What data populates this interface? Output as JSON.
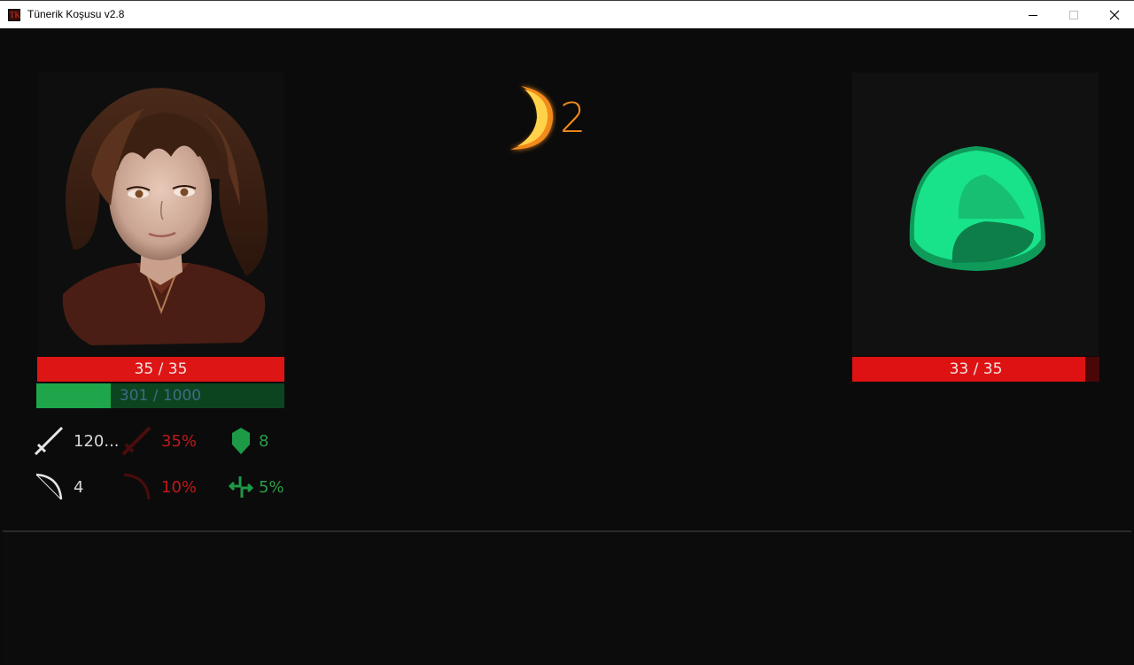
{
  "window": {
    "title": "Tünerik Koşusu v2.8",
    "icon_label": "TK"
  },
  "player": {
    "hp_text": "35 / 35",
    "hp_fraction": 1.0,
    "xp_text": "301 / 1000",
    "xp_fraction": 0.301
  },
  "enemy": {
    "hp_text": "33 / 35",
    "hp_fraction": 0.943
  },
  "turn": {
    "count": "2"
  },
  "stats": {
    "attack": "120...",
    "crit_chance": "35%",
    "defense": "8",
    "ranged": "4",
    "ranged_crit": "10%",
    "dodge": "5%"
  },
  "colors": {
    "hp_red": "#de1515",
    "xp_green": "#1fa64a",
    "turn_orange": "#f28a1c",
    "slime_green": "#19e38a"
  }
}
